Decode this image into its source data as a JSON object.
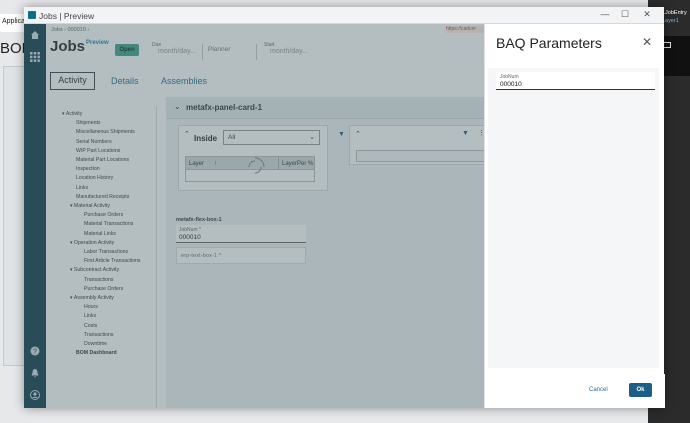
{
  "background": {
    "tab_text": "Applica",
    "bom_text": "BOM",
    "right_text1": "LJobEntry",
    "right_text2": "Layer1"
  },
  "window": {
    "title": "Jobs | Preview",
    "minimize": "—",
    "maximize": "☐",
    "close": "✕"
  },
  "breadcrumb": {
    "item1": "Jobs",
    "sep": "›",
    "item2": "000010"
  },
  "url_fragment": "https://cadcer",
  "header": {
    "title": "Jobs",
    "preview_label": "Preview",
    "status": "Open",
    "due_label": "Due",
    "due_value": "month/day...",
    "planner_label": "Planner",
    "start_label": "Start",
    "start_value": "month/day..."
  },
  "tabs": [
    "Activity",
    "Details",
    "Assemblies"
  ],
  "nav": [
    {
      "label": "Activity",
      "level": 0,
      "caret": true
    },
    {
      "label": "Shipments",
      "level": 1
    },
    {
      "label": "Miscellaneous Shipments",
      "level": 1
    },
    {
      "label": "Serial Numbers",
      "level": 1
    },
    {
      "label": "WIP Part Locations",
      "level": 1
    },
    {
      "label": "Material Part Locations",
      "level": 1
    },
    {
      "label": "Inspection",
      "level": 1
    },
    {
      "label": "Location History",
      "level": 1
    },
    {
      "label": "Links",
      "level": 1
    },
    {
      "label": "Manufactured Receipts",
      "level": 1
    },
    {
      "label": "Material Activity",
      "level": 1,
      "caret": true
    },
    {
      "label": "Purchase Orders",
      "level": 2
    },
    {
      "label": "Material Transactions",
      "level": 2
    },
    {
      "label": "Material Links",
      "level": 2
    },
    {
      "label": "Operation Activity",
      "level": 1,
      "caret": true
    },
    {
      "label": "Labor Transactions",
      "level": 2
    },
    {
      "label": "First Article Transactions",
      "level": 2
    },
    {
      "label": "Subcontract Activity",
      "level": 1,
      "caret": true
    },
    {
      "label": "Transactions",
      "level": 2
    },
    {
      "label": "Purchase Orders",
      "level": 2
    },
    {
      "label": "Assembly Activity",
      "level": 1,
      "caret": true
    },
    {
      "label": "Hours",
      "level": 2
    },
    {
      "label": "Links",
      "level": 2
    },
    {
      "label": "Costs",
      "level": 2
    },
    {
      "label": "Transactions",
      "level": 2
    },
    {
      "label": "Downtime",
      "level": 2
    },
    {
      "label": "BOM Dashboard",
      "level": 1,
      "bold": true
    }
  ],
  "panel_card": {
    "title": "metafx-panel-card-1",
    "inside_label": "Inside",
    "select_value": "All",
    "grid_col1": "Layer",
    "grid_col2": "LayerPer %",
    "flex_box_label": "metafx-flex-box-1",
    "jobnum_label": "JobNum *",
    "jobnum_value": "000010",
    "erp_text_label": "erp-text-box-1 *"
  },
  "baq": {
    "title": "BAQ Parameters",
    "jobnum_label": "JobNum",
    "jobnum_value": "000010",
    "cancel_label": "Cancel",
    "ok_label": "Ok"
  }
}
